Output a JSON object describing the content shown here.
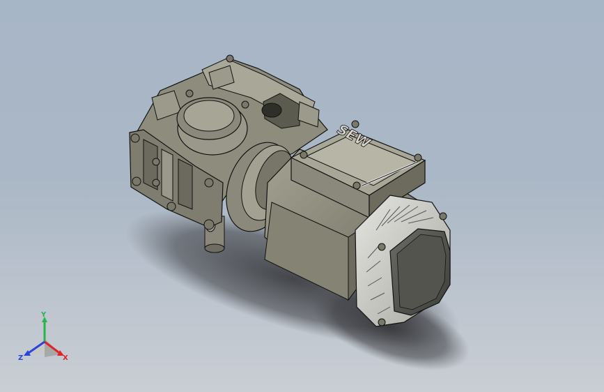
{
  "model": {
    "brand_label": "SEW",
    "body_color": "#8e8c7c",
    "body_dark": "#5c5b50",
    "body_light": "#b5b3a3",
    "fan_cover_color": "#c9c9c3"
  },
  "triad": {
    "x_label": "X",
    "y_label": "Y",
    "z_label": "Z",
    "x_color": "#e0242a",
    "y_color": "#29b34a",
    "z_color": "#2a45d6"
  }
}
